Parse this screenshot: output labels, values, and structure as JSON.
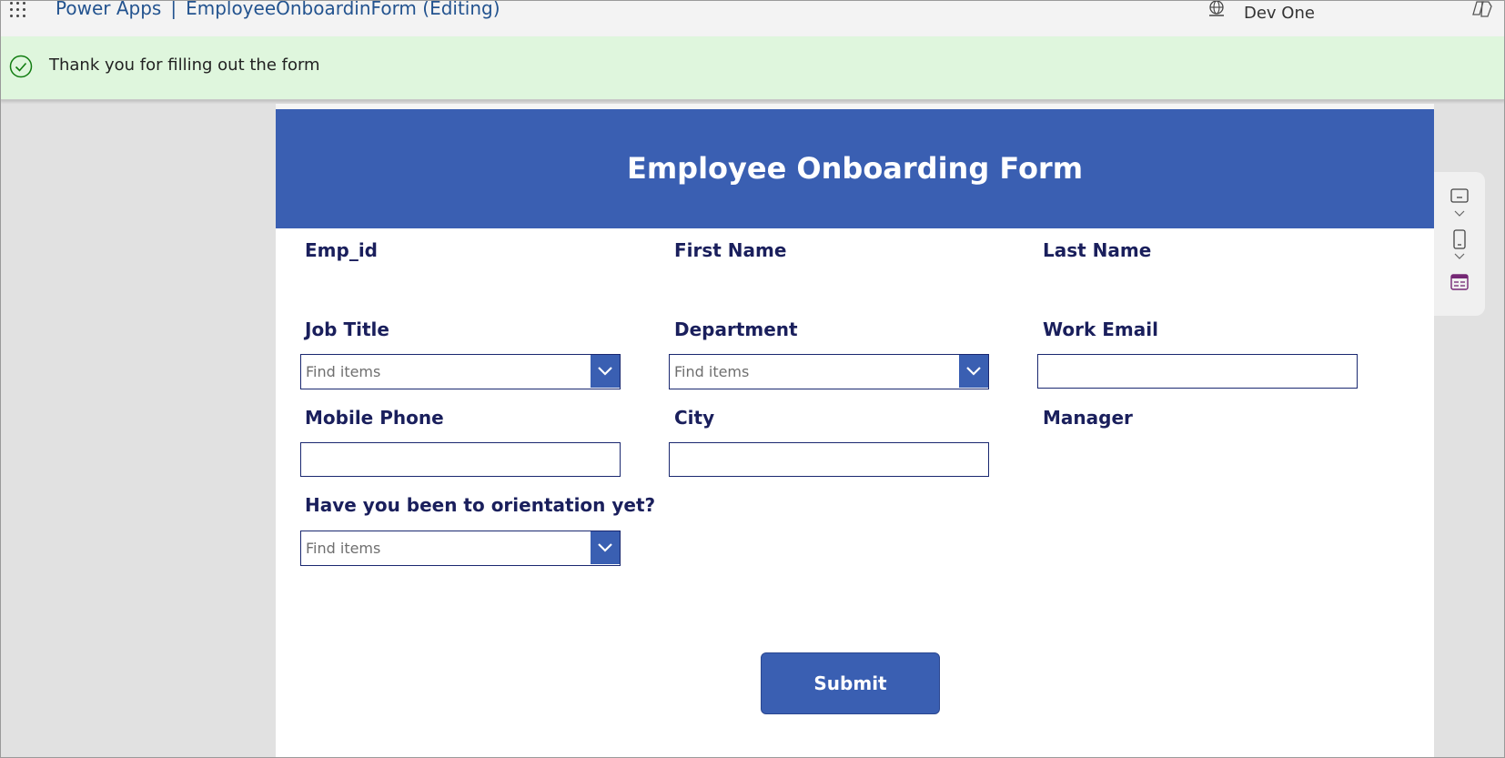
{
  "topbar": {
    "app_name": "Power Apps",
    "separator": "|",
    "document_title": "EmployeeOnboardinForm (Editing)",
    "environment_name": "Dev One",
    "icons": [
      "waffle-icon",
      "environment-globe-icon",
      "copilot-icon"
    ]
  },
  "notification": {
    "message": "Thank you for filling out the form",
    "status": "success",
    "icon": "checkmark-circle-icon",
    "color": "#dff6dd"
  },
  "form": {
    "title": "Employee Onboarding Form",
    "header_color": "#3a5fb2",
    "fields": {
      "emp_id": {
        "label": "Emp_id"
      },
      "first_name": {
        "label": "First Name"
      },
      "last_name": {
        "label": "Last Name"
      },
      "job_title": {
        "label": "Job Title",
        "placeholder": "Find items"
      },
      "department": {
        "label": "Department",
        "placeholder": "Find items"
      },
      "work_email": {
        "label": "Work Email",
        "value": ""
      },
      "mobile_phone": {
        "label": "Mobile Phone",
        "value": ""
      },
      "city": {
        "label": "City",
        "value": ""
      },
      "manager": {
        "label": "Manager"
      },
      "orientation": {
        "label": "Have you been to orientation yet?",
        "placeholder": "Find items"
      }
    },
    "submit_label": "Submit"
  },
  "side_toolbar": {
    "icons": [
      "desktop-layout-icon",
      "chevron-down-icon",
      "phone-layout-icon",
      "chevron-down-icon",
      "form-view-icon"
    ]
  }
}
